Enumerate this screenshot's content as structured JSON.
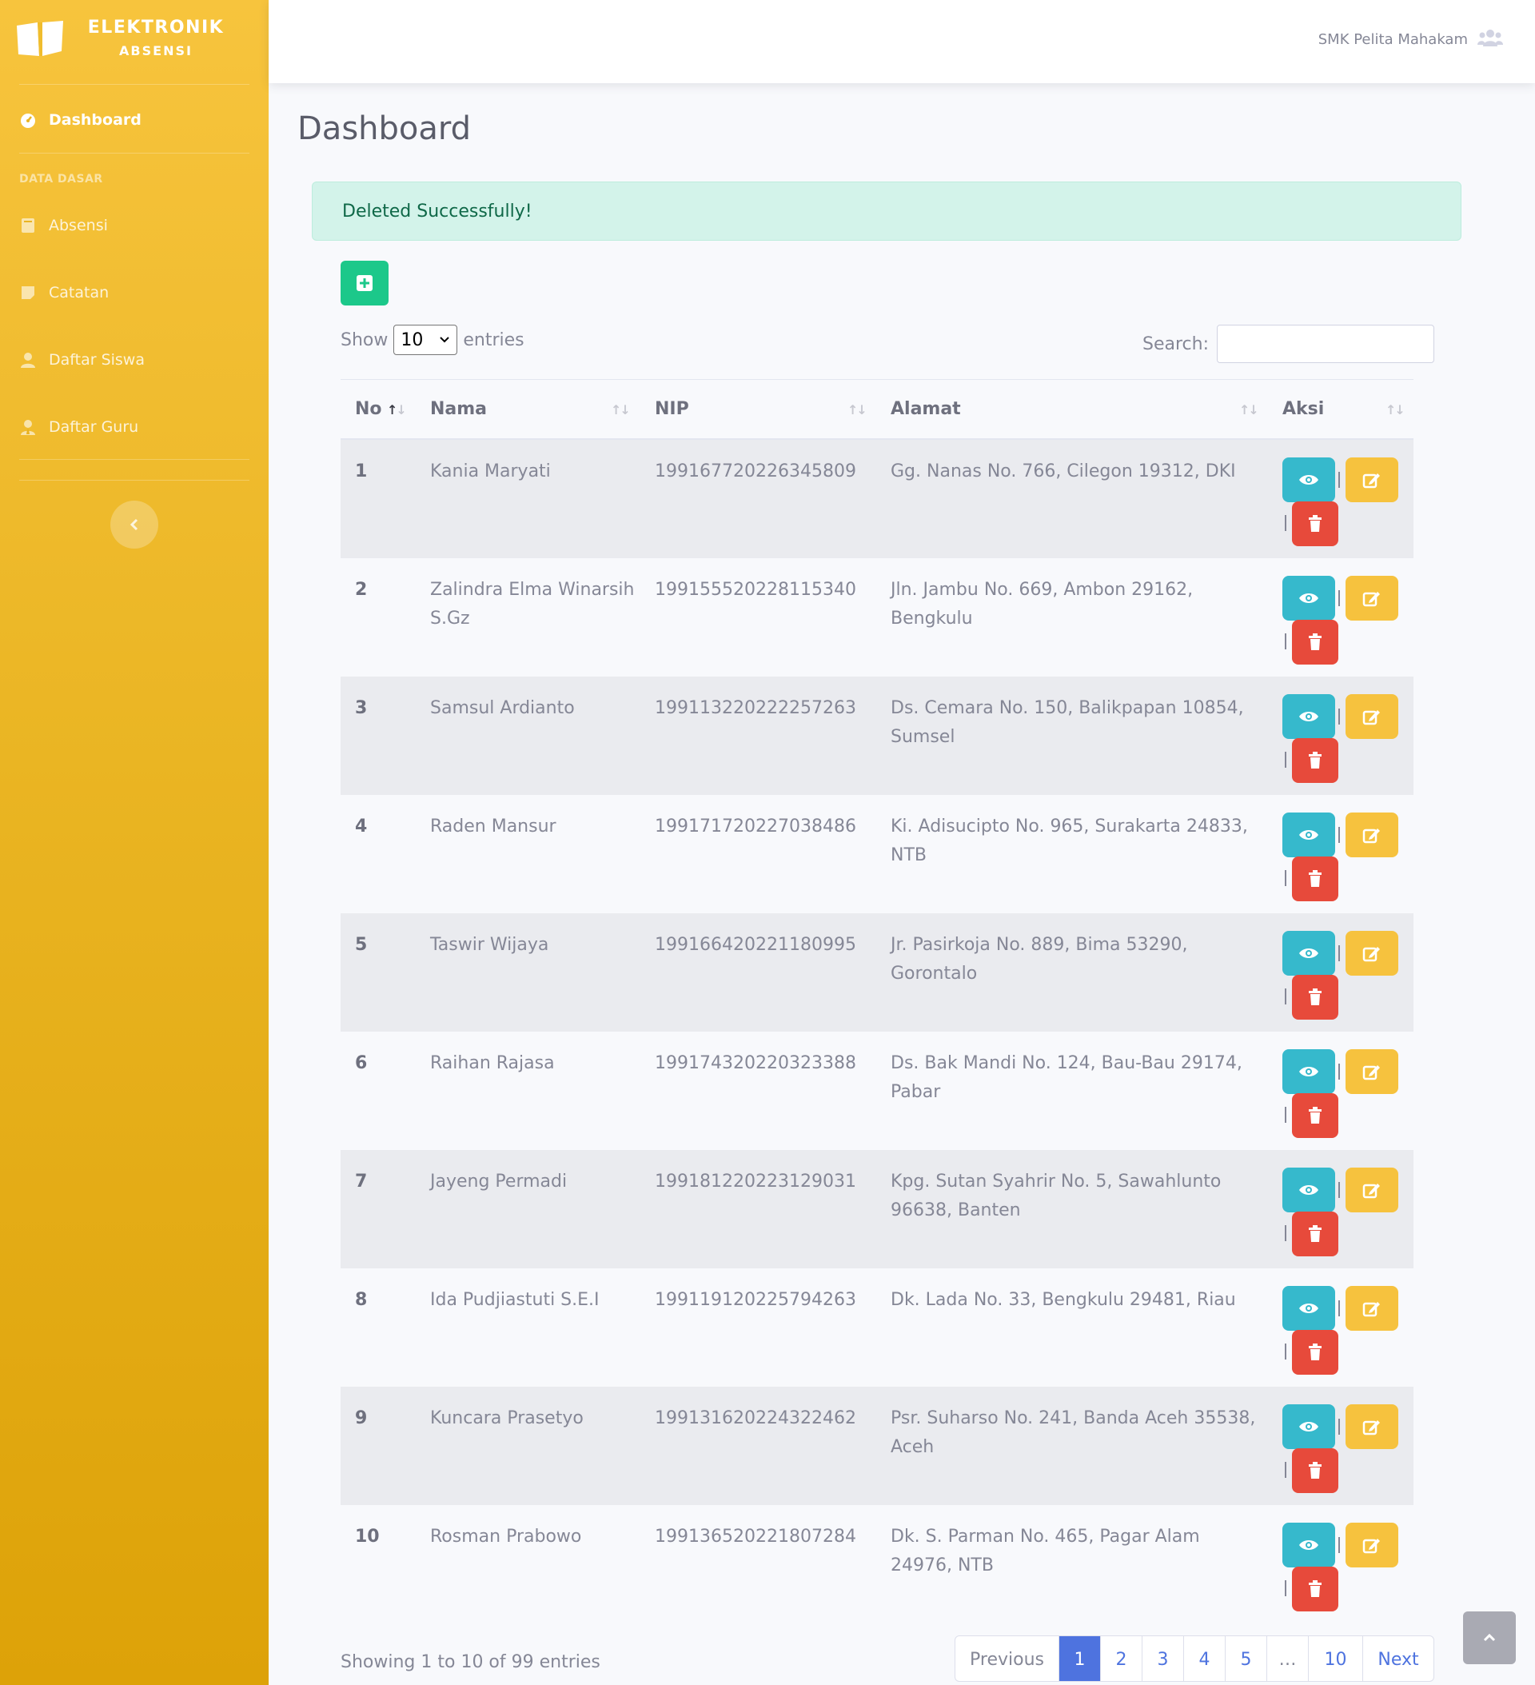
{
  "brand": {
    "line1": "ELEKTRONIK",
    "line2": "ABSENSI"
  },
  "sidebar": {
    "dashboard": "Dashboard",
    "heading": "DATA DASAR",
    "items": [
      {
        "label": "Absensi",
        "icon": "book-icon"
      },
      {
        "label": "Catatan",
        "icon": "note-icon"
      },
      {
        "label": "Daftar Siswa",
        "icon": "user-icon"
      },
      {
        "label": "Daftar Guru",
        "icon": "user-tie-icon"
      }
    ]
  },
  "topbar": {
    "user": "SMK Pelita Mahakam",
    "icon": "users-icon"
  },
  "page": {
    "title": "Dashboard"
  },
  "alert": {
    "message": "Deleted Successfully!"
  },
  "table_controls": {
    "show": "Show",
    "entries_value": "10",
    "entries": "entries",
    "search_label": "Search:",
    "search_value": ""
  },
  "table": {
    "headers": [
      "No",
      "Nama",
      "NIP",
      "Alamat",
      "Aksi"
    ],
    "rows": [
      {
        "no": "1",
        "nama": "Kania Maryati",
        "nip": "199167720226345809",
        "alamat": "Gg. Nanas No. 766, Cilegon 19312, DKI"
      },
      {
        "no": "2",
        "nama": "Zalindra Elma Winarsih S.Gz",
        "nip": "199155520228115340",
        "alamat": "Jln. Jambu No. 669, Ambon 29162, Bengkulu"
      },
      {
        "no": "3",
        "nama": "Samsul Ardianto",
        "nip": "199113220222257263",
        "alamat": "Ds. Cemara No. 150, Balikpapan 10854, Sumsel"
      },
      {
        "no": "4",
        "nama": "Raden Mansur",
        "nip": "199171720227038486",
        "alamat": "Ki. Adisucipto No. 965, Surakarta 24833, NTB"
      },
      {
        "no": "5",
        "nama": "Taswir Wijaya",
        "nip": "199166420221180995",
        "alamat": "Jr. Pasirkoja No. 889, Bima 53290, Gorontalo"
      },
      {
        "no": "6",
        "nama": "Raihan Rajasa",
        "nip": "199174320220323388",
        "alamat": "Ds. Bak Mandi No. 124, Bau-Bau 29174, Pabar"
      },
      {
        "no": "7",
        "nama": "Jayeng Permadi",
        "nip": "199181220223129031",
        "alamat": "Kpg. Sutan Syahrir No. 5, Sawahlunto 96638, Banten"
      },
      {
        "no": "8",
        "nama": "Ida Pudjiastuti S.E.I",
        "nip": "199119120225794263",
        "alamat": "Dk. Lada No. 33, Bengkulu 29481, Riau"
      },
      {
        "no": "9",
        "nama": "Kuncara Prasetyo",
        "nip": "199131620224322462",
        "alamat": "Psr. Suharso No. 241, Banda Aceh 35538, Aceh"
      },
      {
        "no": "10",
        "nama": "Rosman Prabowo",
        "nip": "199136520221807284",
        "alamat": "Dk. S. Parman No. 465, Pagar Alam 24976, NTB"
      }
    ]
  },
  "footer": {
    "info": "Showing 1 to 10 of 99 entries",
    "pages": [
      "Previous",
      "1",
      "2",
      "3",
      "4",
      "5",
      "…",
      "10",
      "Next"
    ],
    "active_page": "1"
  },
  "colors": {
    "sidebar": "#f6c23e",
    "info": "#36b9cc",
    "warning": "#f6c23e",
    "danger": "#e74a3b",
    "success": "#1cc88a",
    "primary": "#4e73df"
  }
}
